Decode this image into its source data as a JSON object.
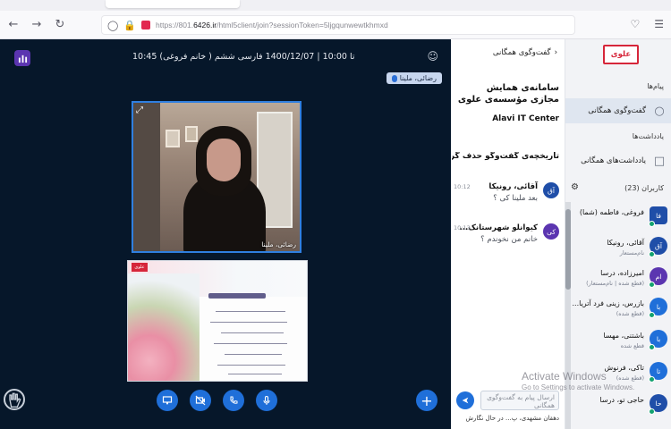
{
  "browser": {
    "url_prefix": "https://801.",
    "url_domain": "6426.ir",
    "url_rest": "/html5client/join?sessionToken=5ljgqunwewtkhmxd",
    "back_icon": "arrow-left",
    "forward_icon": "arrow-right",
    "reload_icon": "reload"
  },
  "meeting": {
    "session_title": "10:45 تا 10:00 | 1400/12/07  فارسی ششم ( خانم فروغی)",
    "talking_name": "رضائی، ملینا",
    "video_name": "رضائی، ملینا",
    "slide_logo": "علوی"
  },
  "chat": {
    "header": "گفت‌وگوی همگانی",
    "title": "سامانه‌ی همایش مجازی مؤسسه‌ی علوی",
    "title_en": "Alavi IT Center",
    "notice": "تاریخچه‌ی گفت‌وگو حذف گردید",
    "messages": [
      {
        "initials": "آق",
        "name": "آقائی، رونیکا",
        "time": "10:12",
        "text": "بعد ملینا کی ؟",
        "color": "#1f4ea8"
      },
      {
        "initials": "کی",
        "name": "کیوانلو شهرستانک...",
        "time": "10:13",
        "text": "خانم من نخوندم ؟",
        "color": "#5b35b0"
      }
    ],
    "input_placeholder": "ارسال پیام به گفت‌وگوی همگانی",
    "typing": "دهقان مشهدی، پ... در حال نگارش"
  },
  "sidebar": {
    "logo": "علوی",
    "messages_label": "پیام‌ها",
    "public_chat": "گفت‌وگوی همگانی",
    "notes_label": "یادداشت‌ها",
    "shared_notes": "یادداشت‌های همگانی",
    "users_label": "کاربران (23)"
  },
  "users": [
    {
      "initials": "فا",
      "name": "فروغی، فاطمه (شما)",
      "role": "",
      "color": "#1f4ea8",
      "round": false
    },
    {
      "initials": "آق",
      "name": "آقائی، رونیکا",
      "role": "نام‌مستعار",
      "color": "#1f4ea8",
      "round": true
    },
    {
      "initials": "ام",
      "name": "امیرزاده، درسا",
      "role": "(قطع شده | نام‌مستعار)",
      "color": "#5b35b0",
      "round": true
    },
    {
      "initials": "با",
      "name": "بازرس، زینی فرد آتریا...",
      "role": "(قطع شده)",
      "color": "#1f6fd9",
      "round": true
    },
    {
      "initials": "با",
      "name": "باشتنی، مهسا",
      "role": "قطع شده",
      "color": "#1f6fd9",
      "round": true
    },
    {
      "initials": "تا",
      "name": "تاکی، فرنوش",
      "role": "(قطع شده)",
      "color": "#1f6fd9",
      "round": true
    },
    {
      "initials": "حا",
      "name": "حاجی تو، درسا",
      "role": "",
      "color": "#1f4ea8",
      "round": true
    }
  ],
  "watermark": {
    "line1": "Activate Windows",
    "line2": "Go to Settings to activate Windows."
  }
}
